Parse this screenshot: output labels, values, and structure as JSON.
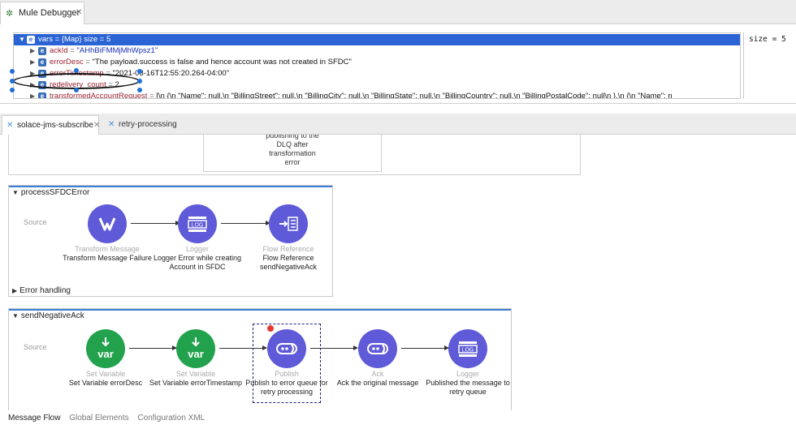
{
  "debugger": {
    "tab_title": "Mule Debugger",
    "rows": [
      {
        "key": "vars",
        "value": "{Map} size = 5"
      },
      {
        "key": "ackId",
        "value": "\"AHhBiFMMjMhWpsz1\""
      },
      {
        "key": "errorDesc",
        "value": "\"The payload.success is false and hence account was not created in SFDC\""
      },
      {
        "key": "errorTimestamp",
        "value": "\"2021-03-16T12:55:20.264-04:00\""
      },
      {
        "key": "redelivery_count",
        "value": "2"
      },
      {
        "key": "transformedAccountRequest",
        "value": "[\\n  {\\n    \"Name\": null,\\n    \"BillingStreet\": null,\\n    \"BillingCity\": null,\\n    \"BillingState\": null,\\n    \"BillingCountry\": null,\\n    \"BillingPostalCode\": null\\n  },\\n  {\\n    \"Name\": n"
      }
    ],
    "detail": "size = 5"
  },
  "editor_tabs": [
    "solace-jms-subscribe",
    "retry-processing"
  ],
  "prev_flow_node_text": "publishing to the\nDLQ after\ntransformation\nerror",
  "flows": [
    {
      "name": "processSFDCError",
      "source_label": "Source",
      "error_handling": "Error handling",
      "nodes": [
        {
          "type": "Transform Message",
          "label": "Transform Message Failure",
          "icon": "transform-icon"
        },
        {
          "type": "Logger",
          "label": "Logger Error while creating Account in SFDC",
          "icon": "logger-icon"
        },
        {
          "type": "Flow Reference",
          "label": "Flow Reference sendNegativeAck",
          "icon": "flow-reference-icon"
        }
      ]
    },
    {
      "name": "sendNegativeAck",
      "source_label": "Source",
      "nodes": [
        {
          "type": "Set Variable",
          "label": "Set Variable errorDesc",
          "icon": "set-variable-icon"
        },
        {
          "type": "Set Variable",
          "label": "Set Variable errorTimestamp",
          "icon": "set-variable-icon"
        },
        {
          "type": "Publish",
          "label": "Publish to error queue for retry processing",
          "icon": "publish-icon"
        },
        {
          "type": "Ack",
          "label": "Ack the original message",
          "icon": "ack-icon"
        },
        {
          "type": "Logger",
          "label": "Published the message to retry queue",
          "icon": "logger-icon"
        }
      ]
    }
  ],
  "bottom_tabs": [
    "Message Flow",
    "Global Elements",
    "Configuration XML"
  ],
  "colors": {
    "connector": "#5e5ad8",
    "setvar": "#23a24d",
    "selection": "#2a63d4",
    "breakpoint": "#e53935"
  }
}
